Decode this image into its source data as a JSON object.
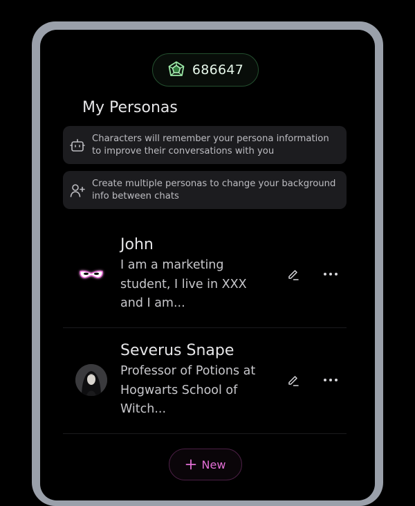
{
  "balance": {
    "value": "686647",
    "icon": "gem-icon"
  },
  "page_title": "My Personas",
  "info_cards": [
    {
      "icon": "bot-icon",
      "text": "Characters will remember your persona information to improve their conversations with you"
    },
    {
      "icon": "user-plus-icon",
      "text": "Create multiple personas to change your background info between chats"
    }
  ],
  "personas": [
    {
      "name": "John",
      "description": "I am a marketing student, I live in XXX and I am...",
      "avatar": "mask-avatar"
    },
    {
      "name": "Severus Snape",
      "description": "Professor of Potions at Hogwarts School of Witch...",
      "avatar": "portrait-avatar"
    }
  ],
  "new_button": {
    "label": "New",
    "icon": "plus-icon"
  },
  "colors": {
    "background": "#000000",
    "frame": "#9aa0aa",
    "card": "#1c1c1f",
    "accent_pink": "#e36fd6",
    "balance_border": "#24502f"
  }
}
